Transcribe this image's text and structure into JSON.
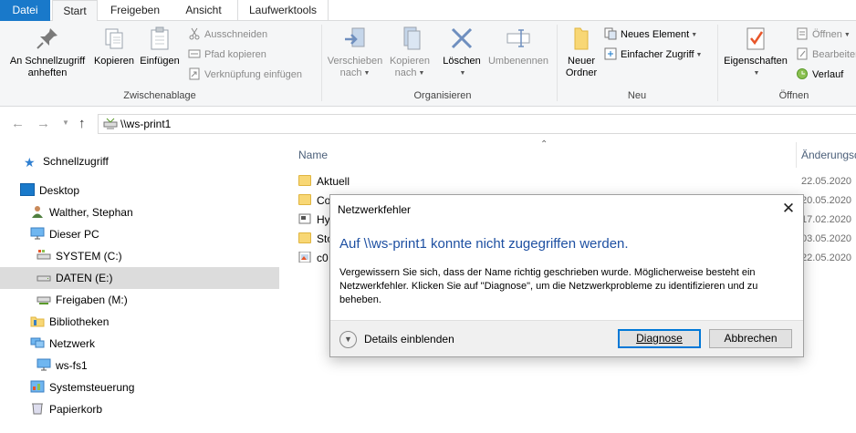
{
  "tabs": [
    "Datei",
    "Start",
    "Freigeben",
    "Ansicht",
    "Laufwerktools"
  ],
  "ribbon": {
    "clipboard": {
      "pin": "An Schnellzugriff anheften",
      "copy": "Kopieren",
      "paste": "Einfügen",
      "cut": "Ausschneiden",
      "copy_path": "Pfad kopieren",
      "paste_shortcut": "Verknüpfung einfügen",
      "label": "Zwischenablage"
    },
    "organize": {
      "move_to": "Verschieben nach",
      "copy_to": "Kopieren nach",
      "delete": "Löschen",
      "rename": "Umbenennen",
      "label": "Organisieren"
    },
    "new": {
      "new_folder": "Neuer Ordner",
      "new_item": "Neues Element",
      "easy_access": "Einfacher Zugriff",
      "label": "Neu"
    },
    "open": {
      "properties": "Eigenschaften",
      "open": "Öffnen",
      "edit": "Bearbeiten",
      "history": "Verlauf",
      "label": "Öffnen"
    }
  },
  "address": {
    "path": "\\\\ws-print1"
  },
  "nav": {
    "items": [
      "Schnellzugriff",
      "Desktop",
      "Walther, Stephan",
      "Dieser PC",
      "SYSTEM (C:)",
      "DATEN (E:)",
      "Freigaben (M:)",
      "Bibliotheken",
      "Netzwerk",
      "ws-fs1",
      "Systemsteuerung",
      "Papierkorb"
    ]
  },
  "files": {
    "col_name": "Name",
    "col_date": "Änderungsd",
    "rows": [
      {
        "name": "Aktuell",
        "date": "22.05.2020"
      },
      {
        "name": "Co",
        "date": "20.05.2020"
      },
      {
        "name": "Hy",
        "date": "17.02.2020"
      },
      {
        "name": "Sto",
        "date": "03.05.2020"
      },
      {
        "name": "c0",
        "date": "22.05.2020"
      }
    ]
  },
  "dialog": {
    "title": "Netzwerkfehler",
    "heading": "Auf \\\\ws-print1 konnte nicht zugegriffen werden.",
    "message": "Vergewissern Sie sich, dass der Name richtig geschrieben wurde. Möglicherweise besteht ein Netzwerkfehler. Klicken Sie auf \"Diagnose\", um die Netzwerkprobleme zu identifizieren und zu beheben.",
    "details": "Details einblenden",
    "diagnose": "Diagnose",
    "cancel": "Abbrechen"
  },
  "colors": {
    "accent": "#1979ca",
    "heading": "#1e50a2",
    "selection": "#dcdcdc"
  }
}
